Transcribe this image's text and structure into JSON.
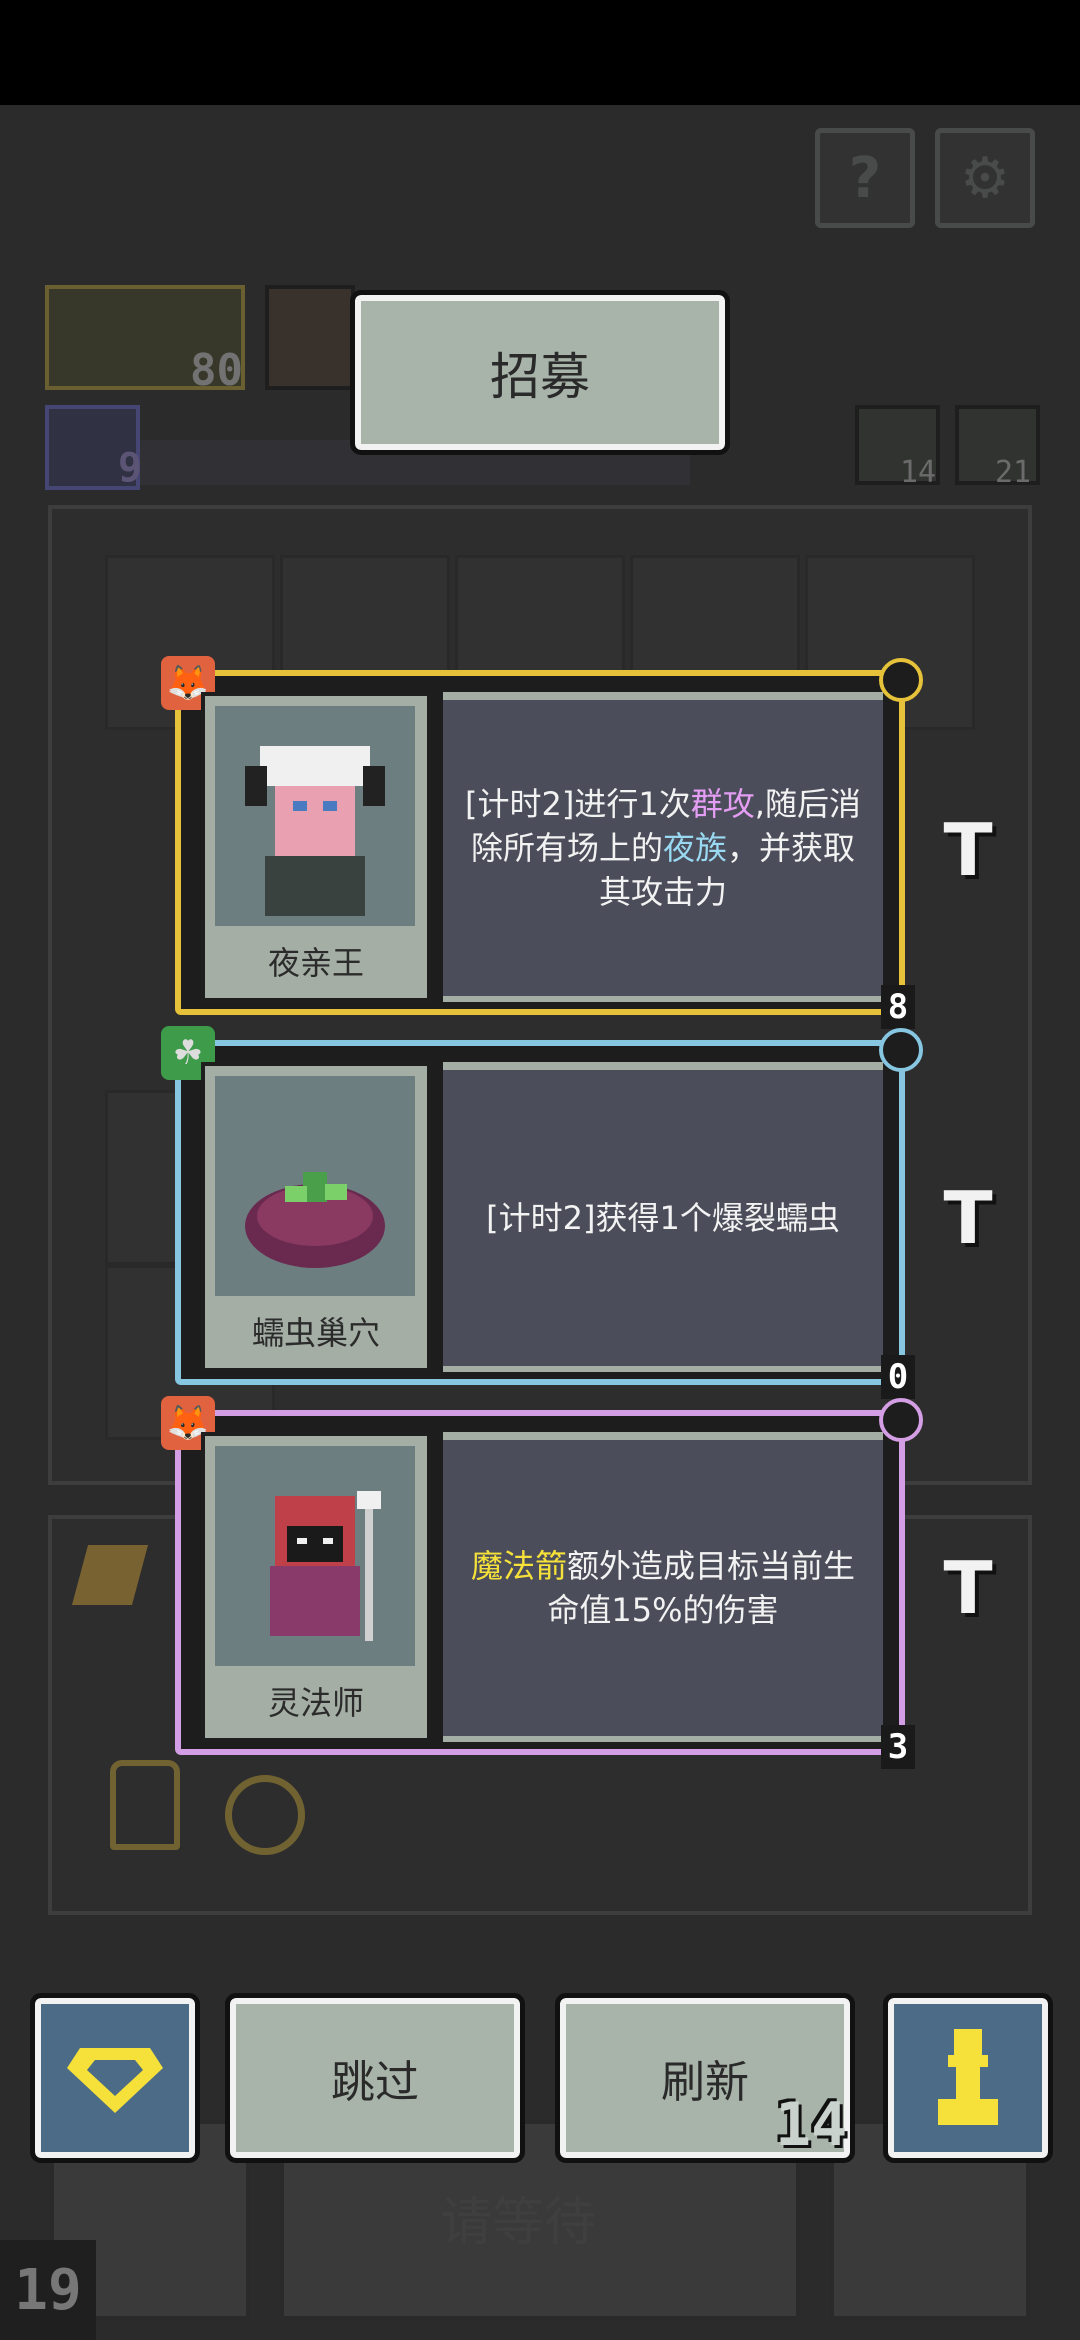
{
  "hud": {
    "help_icon": "?",
    "settings_icon": "gear",
    "resource_value": "80",
    "energy_value": "9",
    "turn_counter": "14",
    "trophy_counter": "21"
  },
  "title": "招募",
  "cards": [
    {
      "name": "夜亲王",
      "badge_icon": "fox-mask",
      "badge_color": "#e0623f",
      "border_color": "#e5c23a",
      "cost": "8",
      "desc_parts": [
        {
          "text": "[计时2]进行1次",
          "color": "#f2f2f2"
        },
        {
          "text": "群攻",
          "color": "#e39df2"
        },
        {
          "text": ",随后消除所有场上的",
          "color": "#f2f2f2"
        },
        {
          "text": "夜族",
          "color": "#9ad9f2"
        },
        {
          "text": "，并获取其攻击力",
          "color": "#f2f2f2"
        }
      ]
    },
    {
      "name": "蠕虫巢穴",
      "badge_icon": "clover",
      "badge_color": "#3d9b4a",
      "border_color": "#86c6e0",
      "cost": "0",
      "desc_parts": [
        {
          "text": "[计时2]获得1个",
          "color": "#f2f2f2"
        },
        {
          "text": "爆裂蠕虫",
          "color": "#f2f2f2"
        }
      ]
    },
    {
      "name": "灵法师",
      "badge_icon": "fox-mask",
      "badge_color": "#e0623f",
      "border_color": "#d39ee3",
      "cost": "3",
      "desc_parts": [
        {
          "text": "魔法箭",
          "color": "#f5e13a"
        },
        {
          "text": "额外造成目标当前生命值15%的伤害",
          "color": "#f2f2f2"
        }
      ]
    }
  ],
  "lock_icon": "T",
  "buttons": {
    "shop_icon": "diamond",
    "skip_label": "跳过",
    "refresh_label": "刷新",
    "refresh_cost": "14",
    "pawn_icon": "pawn"
  },
  "background": {
    "wait_label": "请等待",
    "round_number": "19"
  },
  "colors": {
    "card_border_gold": "#e5c23a",
    "card_border_blue": "#86c6e0",
    "card_border_purple": "#d39ee3",
    "button_face": "#a8b4aa",
    "icon_button_face": "#4c6b86",
    "highlight_yellow": "#f5e13a"
  }
}
